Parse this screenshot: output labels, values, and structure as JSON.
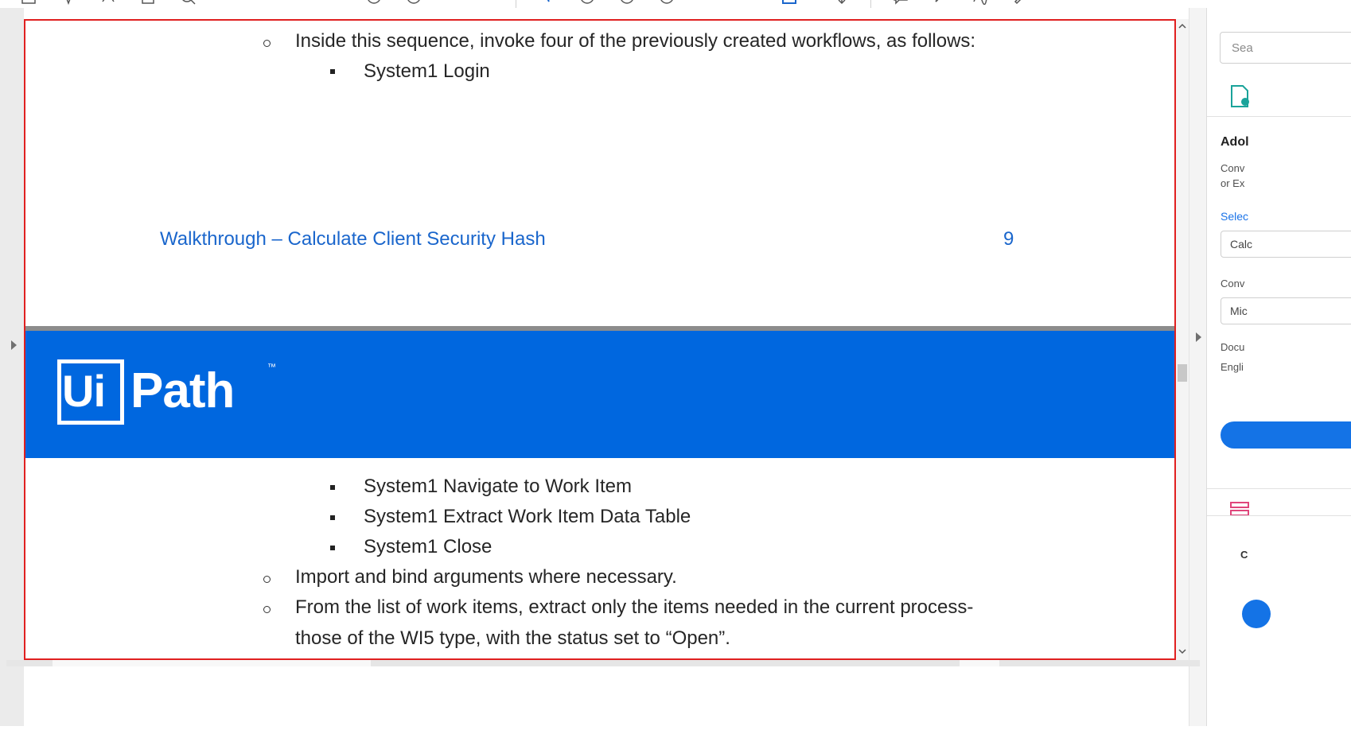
{
  "toolbar": {
    "icons": [
      "save-icon",
      "bookmark-icon",
      "upload-icon",
      "print-icon",
      "search-icon",
      "page-up-icon",
      "page-down-icon",
      "select-cursor-icon",
      "zoom-out-icon",
      "zoom-in-icon",
      "zoom-reset-icon",
      "fit-page-icon",
      "scroll-mode-icon",
      "comment-icon",
      "highlight-icon",
      "sign-icon",
      "edit-icon"
    ]
  },
  "document": {
    "top_page": {
      "bullet1": "Inside this sequence, invoke four of the previously created workflows, as follows:",
      "sub1": "System1 Login",
      "toc_title": "Walkthrough – Calculate Client Security Hash",
      "toc_page": "9"
    },
    "banner": {
      "logo_ui": "Ui",
      "logo_path": "Path",
      "logo_tm": "™"
    },
    "bottom_page": {
      "sub2": "System1 Navigate to Work Item",
      "sub3": "System1 Extract Work Item Data Table",
      "sub4": "System1 Close",
      "bullet2": "Import and bind arguments where necessary.",
      "bullet3_line1": "From the list of work items, extract only the items needed in the current process-",
      "bullet3_line2": "those of the WI5 type, with the status set to “Open”."
    }
  },
  "right_pane": {
    "search_placeholder": "Sea",
    "title": "Adol",
    "desc_line1": "Conv",
    "desc_line2": "or Ex",
    "select_link": "Selec",
    "select1_value": "Calc",
    "convert_label": "Conv",
    "select2_value": "Mic",
    "doc_label": "Docu",
    "doc_lang": "Engli",
    "short_label": "C"
  },
  "colors": {
    "banner": "#0067df",
    "toc_link": "#1a66cc",
    "frame": "#e02020"
  }
}
